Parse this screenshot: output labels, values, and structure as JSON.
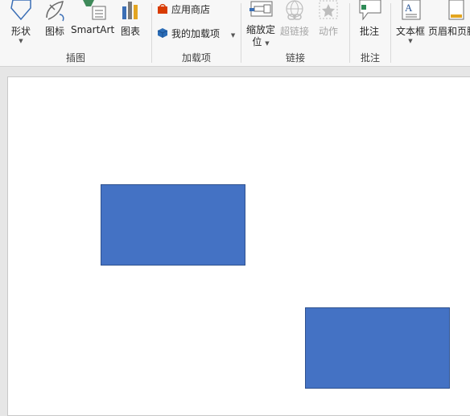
{
  "ribbon": {
    "illustrations": {
      "group_label": "插图",
      "shapes_label": "形状",
      "icons_label": "图标",
      "smartart_label": "SmartArt",
      "chart_label": "图表"
    },
    "addins": {
      "group_label": "加载项",
      "store_label": "应用商店",
      "my_addins_label": "我的加载项"
    },
    "links": {
      "group_label": "链接",
      "zoom_label_line1": "缩放定",
      "zoom_label_line2": "位",
      "hyperlink_label": "超链接",
      "action_label": "动作"
    },
    "comments": {
      "group_label": "批注",
      "comment_label": "批注"
    },
    "text": {
      "textbox_label": "文本框",
      "header_footer_label": "页眉和页脚"
    }
  },
  "colors": {
    "shape_fill": "#4472c4",
    "shape_border": "#2f528f",
    "ribbon_bg": "#f7f7f7",
    "workspace_bg": "#e6e6e6"
  }
}
